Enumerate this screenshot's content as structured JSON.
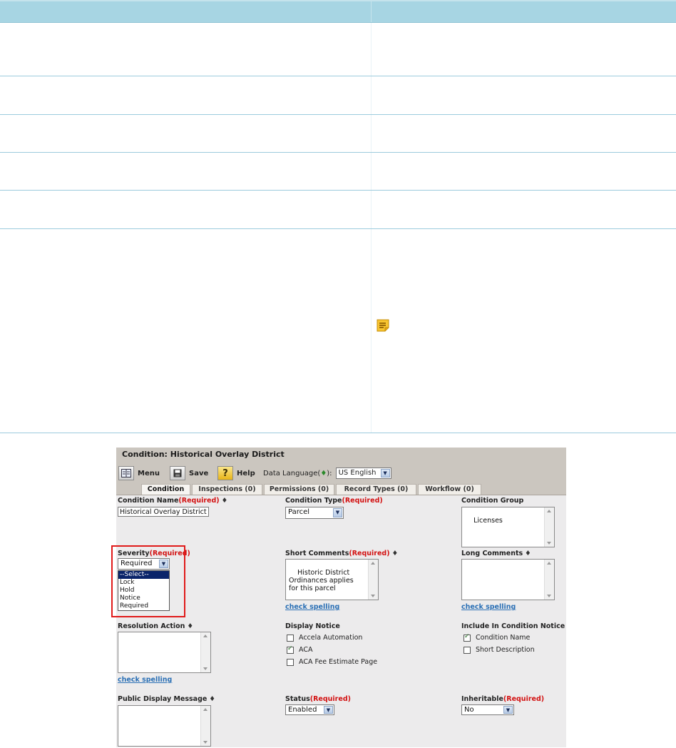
{
  "condition_form": {
    "title": "Condition: Historical Overlay District",
    "toolbar": {
      "menu_label": "Menu",
      "save_label": "Save",
      "help_label": "Help",
      "language_label": "Data Language(",
      "language_diamond": "♦",
      "language_close": "):",
      "language_value": "US English"
    },
    "tabs": [
      {
        "label": "Condition",
        "active": true
      },
      {
        "label": "Inspections (0)",
        "active": false
      },
      {
        "label": "Permissions (0)",
        "active": false
      },
      {
        "label": "Record Types (0)",
        "active": false
      },
      {
        "label": "Workflow (0)",
        "active": false
      }
    ],
    "required_marker": "(Required)",
    "diamond": "♦",
    "condition_name": {
      "label": "Condition Name",
      "value": "Historical Overlay District"
    },
    "condition_type": {
      "label": "Condition Type",
      "value": "Parcel"
    },
    "condition_group": {
      "label": "Condition Group",
      "value": "Licenses"
    },
    "severity": {
      "label": "Severity",
      "value": "Required",
      "options": [
        "--Select--",
        "Lock",
        "Hold",
        "Notice",
        "Required"
      ],
      "highlighted_option": "--Select--"
    },
    "short_comments": {
      "label": "Short Comments",
      "value": "Historic District\nOrdinances applies\nfor this parcel"
    },
    "long_comments": {
      "label": "Long Comments",
      "value": ""
    },
    "check_spelling": "check spelling",
    "resolution_action": {
      "label": "Resolution Action",
      "value": ""
    },
    "display_notice": {
      "label": "Display Notice",
      "options": [
        {
          "label": "Accela Automation",
          "checked": false
        },
        {
          "label": "ACA",
          "checked": true
        },
        {
          "label": "ACA Fee Estimate Page",
          "checked": false
        }
      ]
    },
    "include_in_condition_notice": {
      "label": "Include In Condition Notice",
      "options": [
        {
          "label": "Condition Name",
          "checked": true
        },
        {
          "label": "Short Description",
          "checked": false
        }
      ]
    },
    "public_display_message": {
      "label": "Public Display Message",
      "value": ""
    },
    "status": {
      "label": "Status",
      "value": "Enabled"
    },
    "inheritable": {
      "label": "Inheritable",
      "value": "No"
    }
  },
  "colors": {
    "table_header": "#a7d5e3",
    "table_row_border": "#9ccbdd",
    "required_red": "#d31212",
    "link_blue": "#2b70b5",
    "highlight_red": "#e01a1a"
  }
}
